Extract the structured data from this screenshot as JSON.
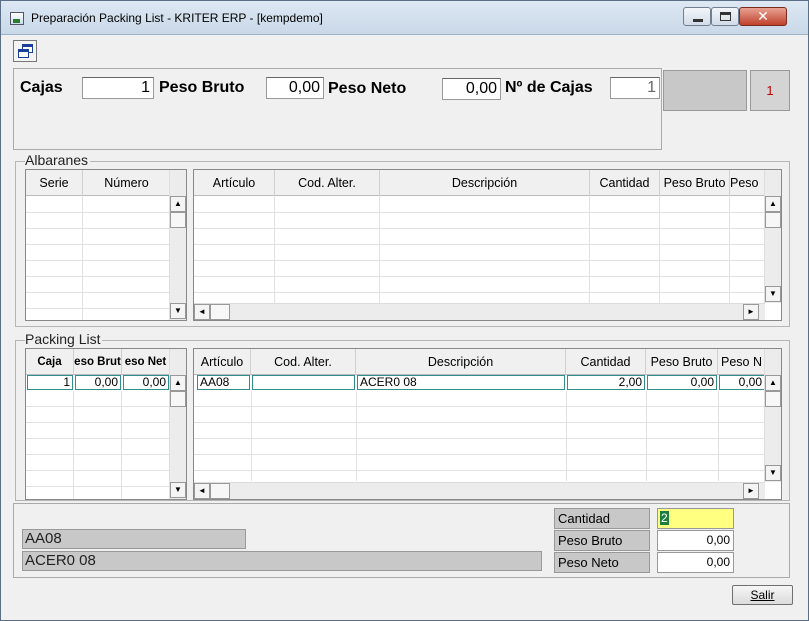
{
  "window": {
    "title": "Preparación Packing List - KRITER ERP - [kempdemo]",
    "close_glyph": "✕"
  },
  "header": {
    "cajas_label": "Cajas",
    "cajas_value": "1",
    "peso_bruto_label": "Peso Bruto",
    "peso_bruto_value": "0,00",
    "peso_neto_label": "Peso Neto",
    "peso_neto_value": "0,00",
    "num_cajas_label": "Nº de Cajas",
    "num_cajas_value": "1",
    "counter": "1"
  },
  "albaranes": {
    "label": "Albaranes",
    "left_columns": [
      "Serie",
      "Número"
    ],
    "right_columns": [
      "Artículo",
      "Cod. Alter.",
      "Descripción",
      "Cantidad",
      "Peso Bruto",
      "Peso"
    ]
  },
  "packing": {
    "label": "Packing List",
    "left_columns": [
      "Caja",
      "eso Brut",
      "eso Net"
    ],
    "left_row": [
      "1",
      "0,00",
      "0,00"
    ],
    "right_columns": [
      "Artículo",
      "Cod. Alter.",
      "Descripción",
      "Cantidad",
      "Peso Bruto",
      "Peso N"
    ],
    "right_row": [
      "AA08",
      "",
      "ACER0 08",
      "2,00",
      "0,00",
      "0,00"
    ]
  },
  "status": {
    "articulo": "AA08",
    "descripcion": "ACER0 08",
    "cantidad_label": "Cantidad",
    "cantidad_value": "2",
    "peso_bruto_label": "Peso Bruto",
    "peso_bruto_value": "0,00",
    "peso_neto_label": "Peso Neto",
    "peso_neto_value": "0,00"
  },
  "buttons": {
    "salir": "Salir"
  },
  "scroll": {
    "up": "▲",
    "down": "▼",
    "left": "◄",
    "right": "►"
  }
}
